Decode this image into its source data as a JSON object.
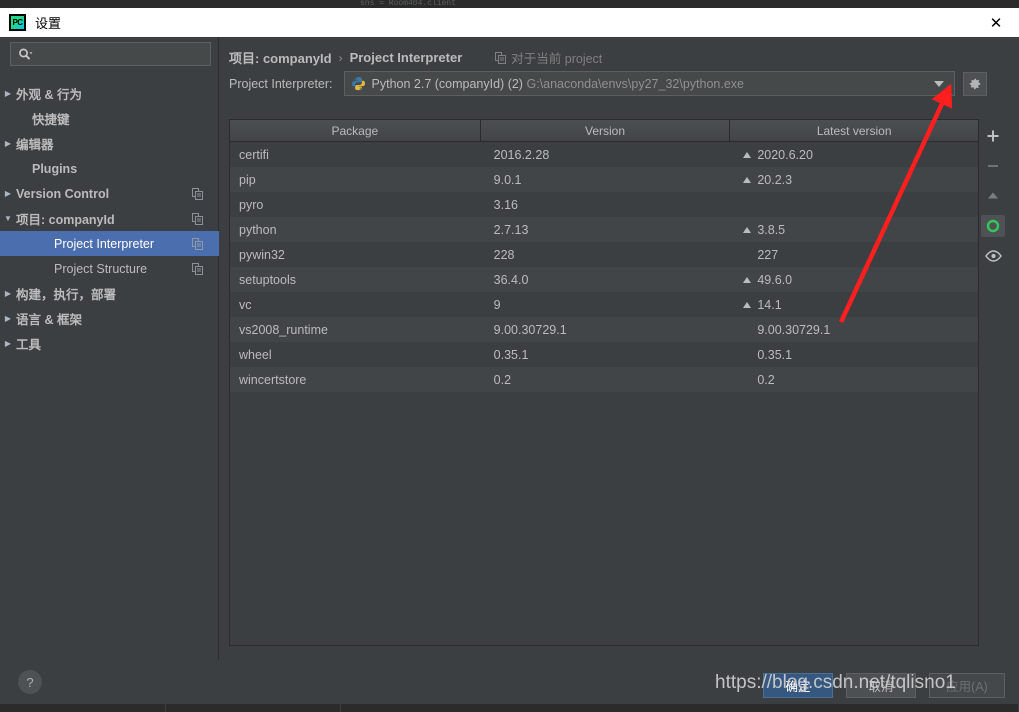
{
  "window": {
    "title": "设置",
    "logo_text": "PC",
    "close_label": "✕",
    "top_strip_code": "sns = Room404.client"
  },
  "sidebar": {
    "search": {
      "placeholder": "",
      "value": "",
      "icon": "search-icon"
    },
    "items": [
      {
        "label": "外观 & 行为",
        "arrow": "▶",
        "indent": 8,
        "bold": true,
        "selected": false,
        "copy": false
      },
      {
        "label": "快捷键",
        "arrow": "",
        "indent": 24,
        "bold": true,
        "selected": false,
        "copy": false
      },
      {
        "label": "编辑器",
        "arrow": "▶",
        "indent": 8,
        "bold": true,
        "selected": false,
        "copy": false
      },
      {
        "label": "Plugins",
        "arrow": "",
        "indent": 24,
        "bold": true,
        "selected": false,
        "copy": false
      },
      {
        "label": "Version Control",
        "arrow": "▶",
        "indent": 8,
        "bold": true,
        "selected": false,
        "copy": true
      },
      {
        "label": "项目: companyId",
        "arrow": "▼",
        "indent": 8,
        "bold": true,
        "selected": false,
        "copy": true
      },
      {
        "label": "Project Interpreter",
        "arrow": "",
        "indent": 46,
        "bold": false,
        "selected": true,
        "copy": true
      },
      {
        "label": "Project Structure",
        "arrow": "",
        "indent": 46,
        "bold": false,
        "selected": false,
        "copy": true
      },
      {
        "label": "构建，执行，部署",
        "arrow": "▶",
        "indent": 8,
        "bold": true,
        "selected": false,
        "copy": false
      },
      {
        "label": "语言 & 框架",
        "arrow": "▶",
        "indent": 8,
        "bold": true,
        "selected": false,
        "copy": false
      },
      {
        "label": "工具",
        "arrow": "▶",
        "indent": 8,
        "bold": true,
        "selected": false,
        "copy": false
      }
    ]
  },
  "breadcrumb": {
    "project": "项目: companyId",
    "separator": "›",
    "page": "Project Interpreter",
    "scope_note": "对于当前 project"
  },
  "interpreter": {
    "label": "Project Interpreter:",
    "name": "Python 2.7 (companyId) (2)",
    "path": "G:\\anaconda\\envs\\py27_32\\python.exe",
    "icon": "python-icon",
    "gear_icon": "gear-icon"
  },
  "table": {
    "columns": [
      "Package",
      "Version",
      "Latest version"
    ],
    "rows": [
      {
        "package": "certifi",
        "version": "2016.2.28",
        "latest": "2020.6.20",
        "upgrade": true
      },
      {
        "package": "pip",
        "version": "9.0.1",
        "latest": "20.2.3",
        "upgrade": true
      },
      {
        "package": "pyro",
        "version": "3.16",
        "latest": "",
        "upgrade": false
      },
      {
        "package": "python",
        "version": "2.7.13",
        "latest": "3.8.5",
        "upgrade": true
      },
      {
        "package": "pywin32",
        "version": "228",
        "latest": "227",
        "upgrade": false
      },
      {
        "package": "setuptools",
        "version": "36.4.0",
        "latest": "49.6.0",
        "upgrade": true
      },
      {
        "package": "vc",
        "version": "9",
        "latest": "14.1",
        "upgrade": true
      },
      {
        "package": "vs2008_runtime",
        "version": "9.00.30729.1",
        "latest": "9.00.30729.1",
        "upgrade": false
      },
      {
        "package": "wheel",
        "version": "0.35.1",
        "latest": "0.35.1",
        "upgrade": false
      },
      {
        "package": "wincertstore",
        "version": "0.2",
        "latest": "0.2",
        "upgrade": false
      }
    ]
  },
  "side_toolbar": [
    {
      "icon": "plus-icon",
      "name": "install-package-button",
      "active": false
    },
    {
      "icon": "minus-icon",
      "name": "uninstall-package-button",
      "active": false
    },
    {
      "icon": "arrow-up-icon",
      "name": "upgrade-package-button",
      "active": false
    },
    {
      "icon": "refresh-icon",
      "name": "refresh-button",
      "active": true
    },
    {
      "icon": "eye-icon",
      "name": "show-early-releases-button",
      "active": false
    }
  ],
  "footer": {
    "help_label": "?",
    "ok_label": "确定",
    "cancel_label": "取消",
    "apply_label": "应用(A)"
  },
  "annotation": {
    "watermark": "https://blog.csdn.net/tqlisno1",
    "arrow_color": "#ff1f1f"
  },
  "colors": {
    "accent_blue": "#4b6eaf",
    "primary_button": "#365880",
    "panel": "#3c3f41",
    "row_even": "#414547",
    "text": "#bbbbbb"
  }
}
